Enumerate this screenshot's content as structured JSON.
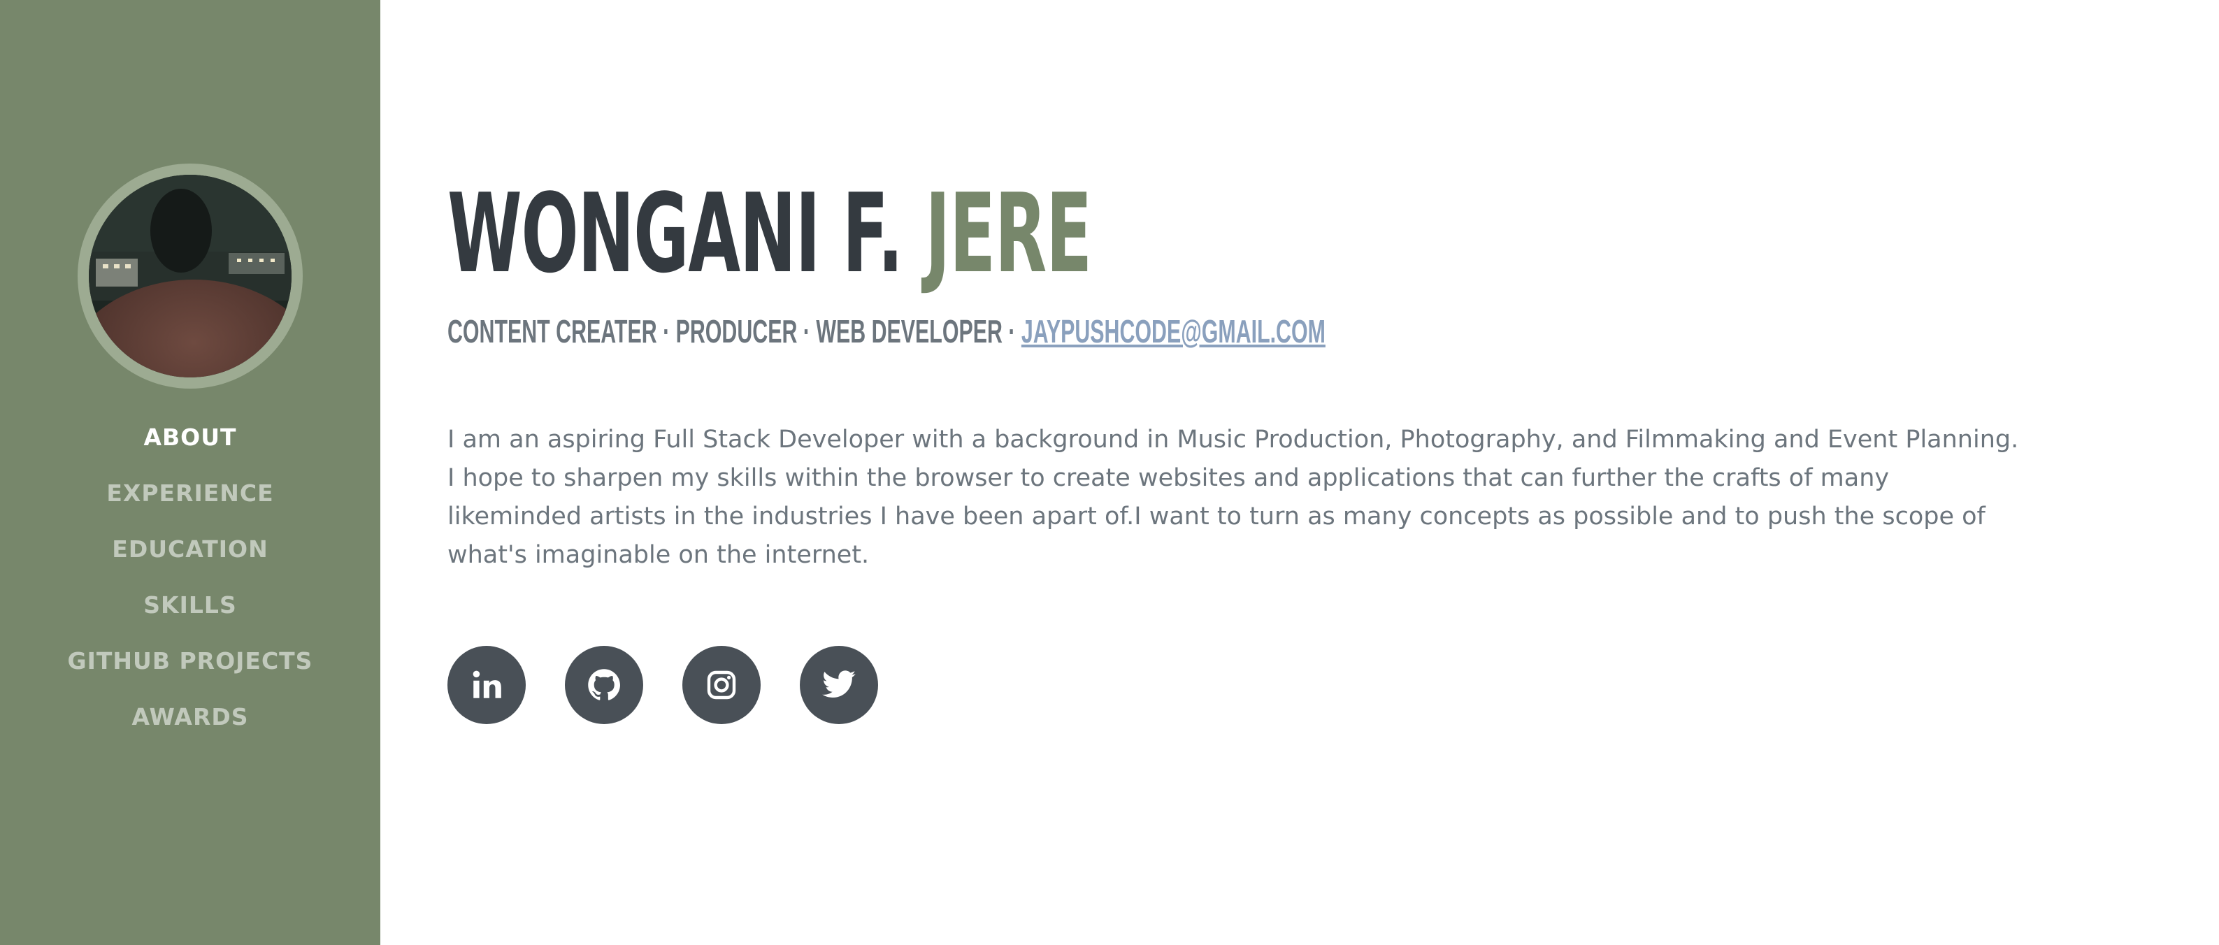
{
  "colors": {
    "sidebar_bg": "#77876b",
    "accent": "#77876b",
    "heading": "#343a40",
    "text": "#6c757d",
    "link": "#8aa0bd",
    "social_bg": "#495057"
  },
  "sidebar": {
    "avatar_alt": "profile photo",
    "nav": [
      {
        "label": "ABOUT",
        "active": true
      },
      {
        "label": "EXPERIENCE",
        "active": false
      },
      {
        "label": "EDUCATION",
        "active": false
      },
      {
        "label": "SKILLS",
        "active": false
      },
      {
        "label": "GITHUB PROJECTS",
        "active": false
      },
      {
        "label": "AWARDS",
        "active": false
      }
    ]
  },
  "about": {
    "first_name": "WONGANI F.",
    "last_name": "JERE",
    "subheading": "CONTENT CREATER · PRODUCER · WEB DEVELOPER ·",
    "email": "JAYPUSHCODE@GMAIL.COM",
    "bio": "I am an aspiring Full Stack Developer with a background in Music Production, Photography, and Filmmaking and Event Planning. I hope to sharpen my skills within the browser to create websites and applications that can further the crafts of many likeminded artists in the industries I have been apart of.I want to turn as many concepts as possible and to push the scope of what's imaginable on the internet."
  },
  "socials": [
    {
      "icon": "linkedin-icon"
    },
    {
      "icon": "github-icon"
    },
    {
      "icon": "instagram-icon"
    },
    {
      "icon": "twitter-icon"
    }
  ]
}
